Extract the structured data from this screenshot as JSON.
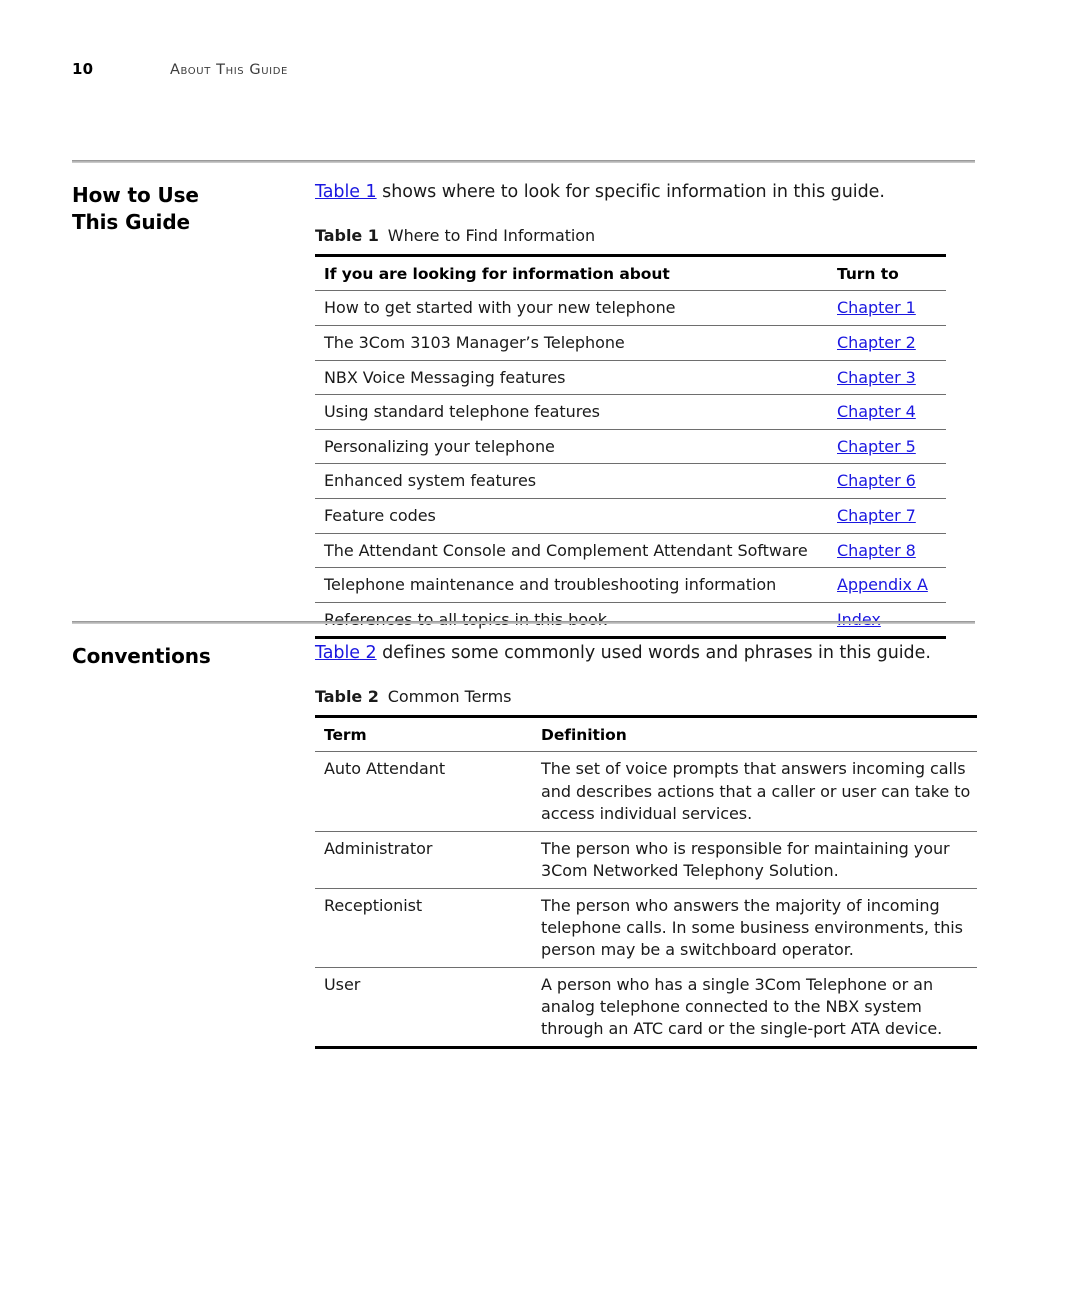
{
  "page": {
    "number": "10",
    "running_head": "About This Guide",
    "link_color": "#1a17e0"
  },
  "sections": {
    "how_to_use": {
      "title": "How to Use\nThis Guide",
      "title_line1": "How to Use",
      "title_line2": "This Guide",
      "intro_link": "Table 1",
      "intro_text": " shows where to look for specific information in this guide.",
      "table_caption_label": "Table 1",
      "table_caption_text": "Where to Find Information",
      "table": {
        "headers": [
          "If you are looking for information about",
          "Turn to"
        ],
        "rows": [
          {
            "description": "How to get started with your new telephone",
            "turn_to": "Chapter 1"
          },
          {
            "description": "The 3Com 3103 Manager’s Telephone",
            "turn_to": "Chapter 2"
          },
          {
            "description": "NBX Voice Messaging features",
            "turn_to": "Chapter 3"
          },
          {
            "description": "Using standard telephone features",
            "turn_to": "Chapter 4"
          },
          {
            "description": "Personalizing your telephone",
            "turn_to": "Chapter 5"
          },
          {
            "description": "Enhanced system features",
            "turn_to": "Chapter 6"
          },
          {
            "description": "Feature codes",
            "turn_to": "Chapter 7"
          },
          {
            "description": "The Attendant Console and Complement Attendant Software",
            "turn_to": "Chapter 8"
          },
          {
            "description": "Telephone maintenance and troubleshooting information",
            "turn_to": "Appendix A"
          },
          {
            "description": "References to all topics in this book",
            "turn_to": "Index"
          }
        ]
      }
    },
    "conventions": {
      "title": "Conventions",
      "intro_link": "Table 2",
      "intro_text": " defines some commonly used words and phrases in this guide.",
      "table_caption_label": "Table 2",
      "table_caption_text": "Common Terms",
      "table": {
        "headers": [
          "Term",
          "Definition"
        ],
        "rows": [
          {
            "term": "Auto Attendant",
            "definition": "The set of voice prompts that answers incoming calls and describes actions that a caller or user can take to access individual services."
          },
          {
            "term": "Administrator",
            "definition": "The person who is responsible for maintaining your 3Com Networked Telephony Solution."
          },
          {
            "term": "Receptionist",
            "definition": "The person who answers the majority of incoming telephone calls. In some business environments, this person may be a switchboard operator."
          },
          {
            "term": "User",
            "definition": "A person who has a single 3Com Telephone or an analog telephone connected to the NBX system through an ATC card or the single-port ATA device."
          }
        ]
      }
    }
  }
}
